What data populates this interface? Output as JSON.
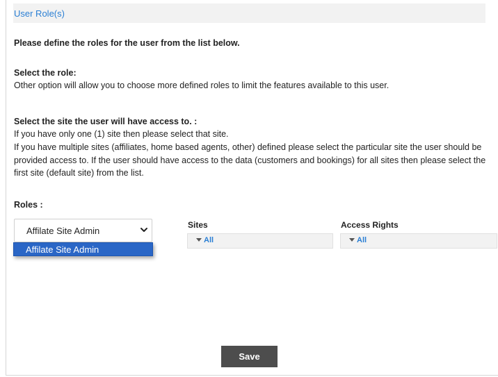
{
  "header": {
    "title": "User Role(s)"
  },
  "intro": "Please define the roles for the user from the list below.",
  "role_section": {
    "heading": "Select the role:",
    "description": "Other option will allow you to choose more defined roles to limit the features available to this user."
  },
  "site_section": {
    "heading": "Select the site the user will have access to. :",
    "line1": "If you have only one (1) site then please select that site.",
    "line2": "If you have multiple sites (affiliates, home based agents, other) defined please select the particular site the user should be provided access to. If the user should have access to the data (customers and bookings) for all sites then please select the first site (default site) from the list."
  },
  "roles": {
    "label": "Roles :",
    "selected": "Affilate Site Admin",
    "options": [
      "Affilate Site Admin"
    ],
    "icon": "chevron-down-icon"
  },
  "sites": {
    "label": "Sites",
    "value": "All",
    "icon": "caret-down-icon"
  },
  "access_rights": {
    "label": "Access Rights",
    "value": "All",
    "icon": "caret-down-icon"
  },
  "actions": {
    "save_label": "Save"
  },
  "colors": {
    "accent": "#2a7fd4",
    "selection": "#2a66c6",
    "button": "#4d4d4d",
    "header_bg": "#f2f2f2"
  }
}
